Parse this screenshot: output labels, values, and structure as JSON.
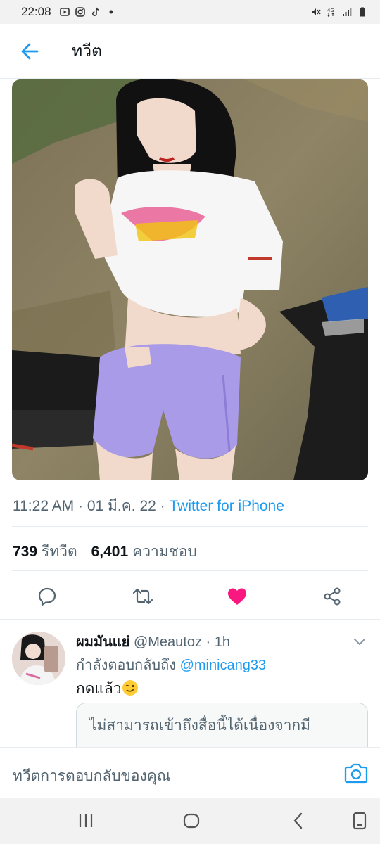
{
  "status_bar": {
    "time": "22:08",
    "left_icons": [
      "play-icon",
      "instagram-icon",
      "tiktok-icon",
      "dot-icon"
    ],
    "right_icons": [
      "mute-icon",
      "4g-icon",
      "signal-icon",
      "battery-icon"
    ],
    "network": "4G"
  },
  "header": {
    "title": "ทวีต",
    "back_icon": "arrow-left-icon"
  },
  "tweet": {
    "time": "11:22 AM",
    "separator": "·",
    "date": "01 มี.ค. 22",
    "source": "Twitter for iPhone",
    "retweets_count": "739",
    "retweets_label": "รีทวีต",
    "likes_count": "6,401",
    "likes_label": "ความชอบ",
    "liked": true
  },
  "actions": {
    "icons": [
      "reply-icon",
      "retweet-icon",
      "heart-icon",
      "share-icon"
    ]
  },
  "reply": {
    "name": "ผมมันแย่",
    "handle": "@Meautoz",
    "separator": "·",
    "time": "1h",
    "replying_to_label": "กำลังตอบกลับถึง",
    "replying_to_handle": "@minicang33",
    "text": "กดแล้ว",
    "media_unavailable": "ไม่สามารถเข้าถึงสื่อนี้ได้เนื่องจากมี"
  },
  "compose": {
    "placeholder": "ทวีตการตอบกลับของคุณ"
  },
  "nav_bar": {
    "icons": [
      "recents-icon",
      "home-icon",
      "back-icon",
      "keyboard-icon"
    ]
  },
  "colors": {
    "accent": "#1d9bf0",
    "like": "#f91880",
    "text_secondary": "#536471",
    "divider": "#e6ecf0"
  }
}
